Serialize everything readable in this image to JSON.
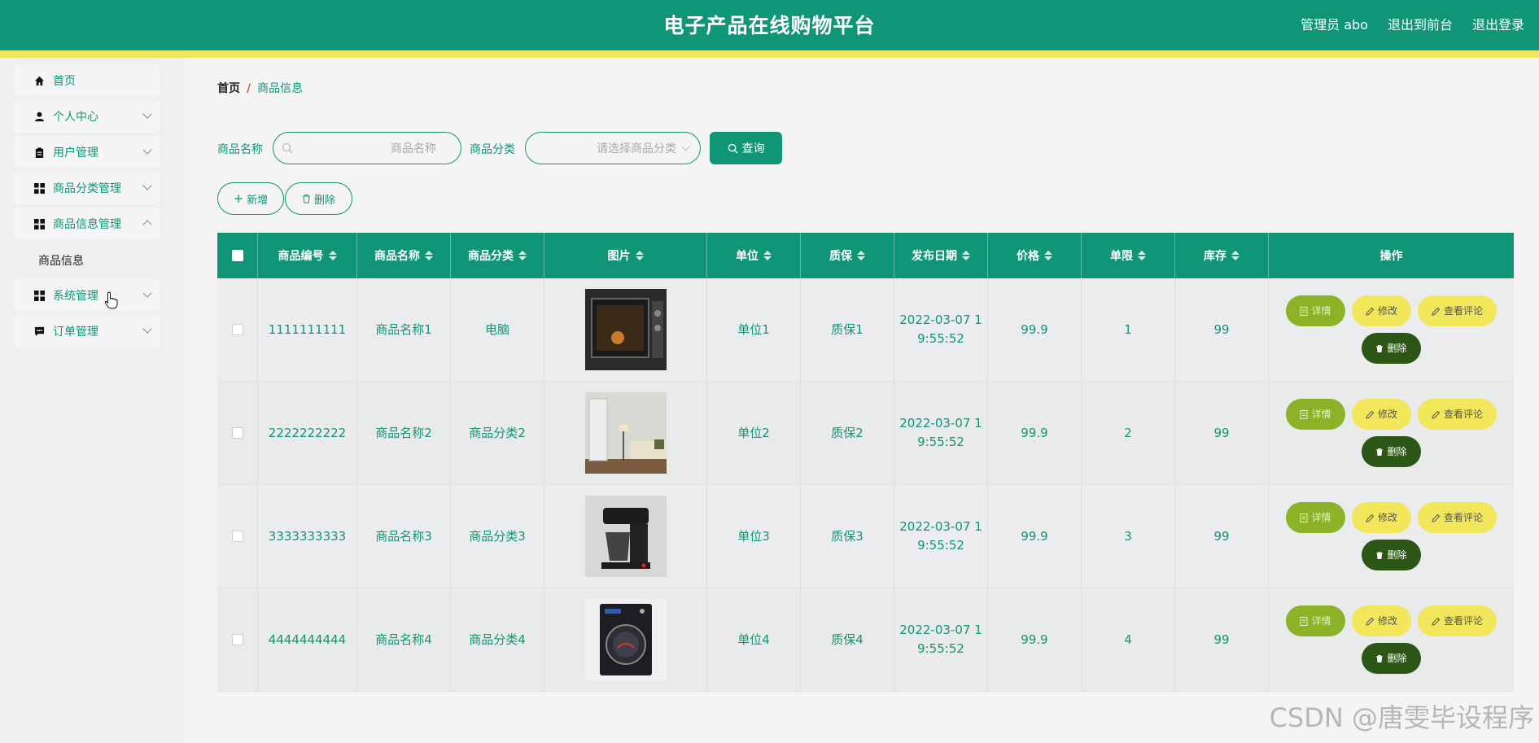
{
  "header": {
    "title": "电子产品在线购物平台",
    "admin_label": "管理员 abo",
    "front_label": "退出到前台",
    "logout_label": "退出登录"
  },
  "sidebar": {
    "items": [
      {
        "label": "首页",
        "icon": "home-icon"
      },
      {
        "label": "个人中心",
        "icon": "user-icon"
      },
      {
        "label": "用户管理",
        "icon": "clipboard-icon"
      },
      {
        "label": "商品分类管理",
        "icon": "grid-icon"
      },
      {
        "label": "商品信息管理",
        "icon": "grid-icon"
      },
      {
        "label": "系统管理",
        "icon": "grid-icon"
      },
      {
        "label": "订单管理",
        "icon": "message-icon"
      }
    ],
    "sub_item": "商品信息"
  },
  "breadcrumb": {
    "home": "首页",
    "sep": "/",
    "current": "商品信息"
  },
  "search": {
    "name_label": "商品名称",
    "name_placeholder": "商品名称",
    "category_label": "商品分类",
    "category_placeholder": "请选择商品分类",
    "query_label": "查询"
  },
  "actions": {
    "add_label": "新增",
    "delete_label": "删除"
  },
  "table": {
    "headers": [
      "商品编号",
      "商品名称",
      "商品分类",
      "图片",
      "单位",
      "质保",
      "发布日期",
      "价格",
      "单限",
      "库存",
      "操作"
    ],
    "rows": [
      {
        "id": "1111111111",
        "name": "商品名称1",
        "category": "电脑",
        "image": "oven",
        "unit": "单位1",
        "warranty": "质保1",
        "date_1": "2022-03-07 1",
        "date_2": "9:55:52",
        "price": "99.9",
        "limit": "1",
        "stock": "99"
      },
      {
        "id": "2222222222",
        "name": "商品名称2",
        "category": "商品分类2",
        "image": "room",
        "unit": "单位2",
        "warranty": "质保2",
        "date_1": "2022-03-07 1",
        "date_2": "9:55:52",
        "price": "99.9",
        "limit": "2",
        "stock": "99"
      },
      {
        "id": "3333333333",
        "name": "商品名称3",
        "category": "商品分类3",
        "image": "coffee-maker",
        "unit": "单位3",
        "warranty": "质保3",
        "date_1": "2022-03-07 1",
        "date_2": "9:55:52",
        "price": "99.9",
        "limit": "3",
        "stock": "99"
      },
      {
        "id": "4444444444",
        "name": "商品名称4",
        "category": "商品分类4",
        "image": "washer",
        "unit": "单位4",
        "warranty": "质保4",
        "date_1": "2022-03-07 1",
        "date_2": "9:55:52",
        "price": "99.9",
        "limit": "4",
        "stock": "99"
      }
    ],
    "ops": {
      "detail": "详情",
      "edit": "修改",
      "review": "查看评论",
      "delete": "删除"
    }
  },
  "watermark": "CSDN @唐雯毕设程序",
  "colors": {
    "primary": "#109577",
    "accent": "#f2e65a",
    "detail": "#8cb228",
    "danger": "#2b5615"
  }
}
